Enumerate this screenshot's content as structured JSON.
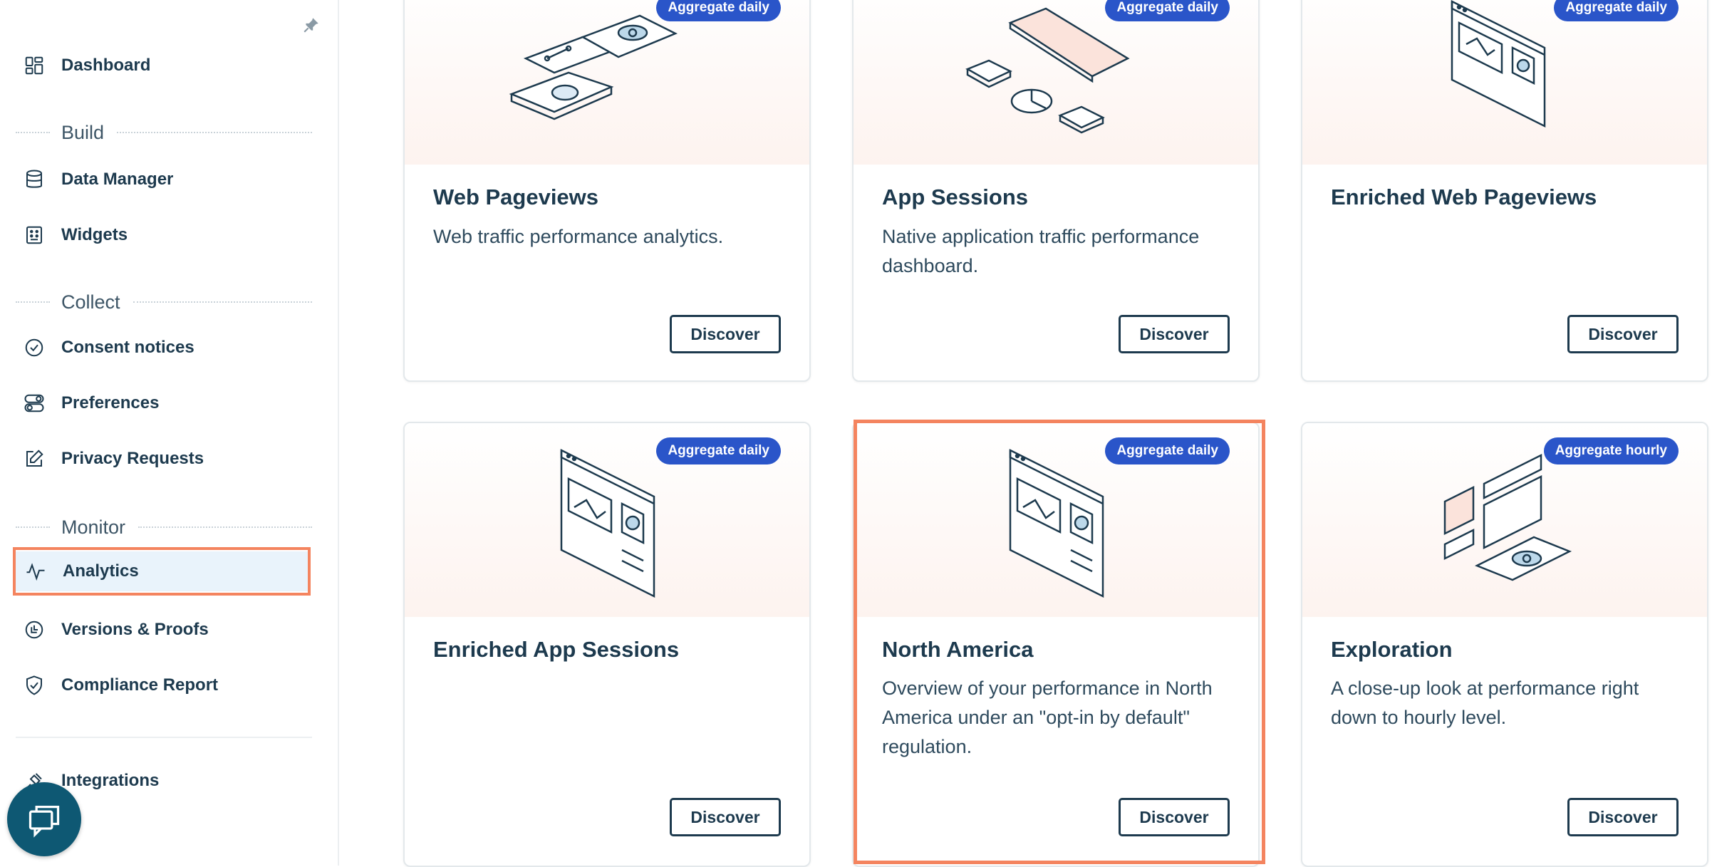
{
  "sidebar": {
    "dashboard": "Dashboard",
    "sections": {
      "build": "Build",
      "collect": "Collect",
      "monitor": "Monitor"
    },
    "items": {
      "data_manager": "Data Manager",
      "widgets": "Widgets",
      "consent_notices": "Consent notices",
      "preferences": "Preferences",
      "privacy_requests": "Privacy Requests",
      "analytics": "Analytics",
      "versions_proofs": "Versions & Proofs",
      "compliance_report": "Compliance Report",
      "integrations": "Integrations"
    },
    "active_item": "Analytics"
  },
  "cards": [
    {
      "badge": "Aggregate daily",
      "title": "Web Pageviews",
      "desc": "Web traffic performance analytics.",
      "button": "Discover"
    },
    {
      "badge": "Aggregate daily",
      "title": "App Sessions",
      "desc": "Native application traffic performance dashboard.",
      "button": "Discover"
    },
    {
      "badge": "Aggregate daily",
      "title": "Enriched Web Pageviews",
      "desc": "",
      "button": "Discover"
    },
    {
      "badge": "Aggregate daily",
      "title": "Enriched App Sessions",
      "desc": "",
      "button": "Discover"
    },
    {
      "badge": "Aggregate daily",
      "title": "North America",
      "desc": "Overview of your performance in North America under an \"opt-in by default\" regulation.",
      "button": "Discover"
    },
    {
      "badge": "Aggregate hourly",
      "title": "Exploration",
      "desc": "A close-up look at performance right down to hourly level.",
      "button": "Discover"
    }
  ],
  "colors": {
    "brand_dark": "#1d3a4e",
    "badge_blue": "#2a55c9",
    "highlight": "#f4845f",
    "active_bg": "#e9f3fb",
    "fab": "#0e5873"
  },
  "icons": {
    "pin": "pin-icon",
    "dashboard": "dashboard-icon",
    "data_manager": "database-icon",
    "widgets": "widget-icon",
    "consent_notices": "check-circle-icon",
    "preferences": "toggle-icon",
    "privacy_requests": "edit-icon",
    "analytics": "pulse-icon",
    "versions_proofs": "history-icon",
    "compliance_report": "shield-check-icon",
    "integrations": "plug-icon",
    "chat": "chat-icon"
  }
}
